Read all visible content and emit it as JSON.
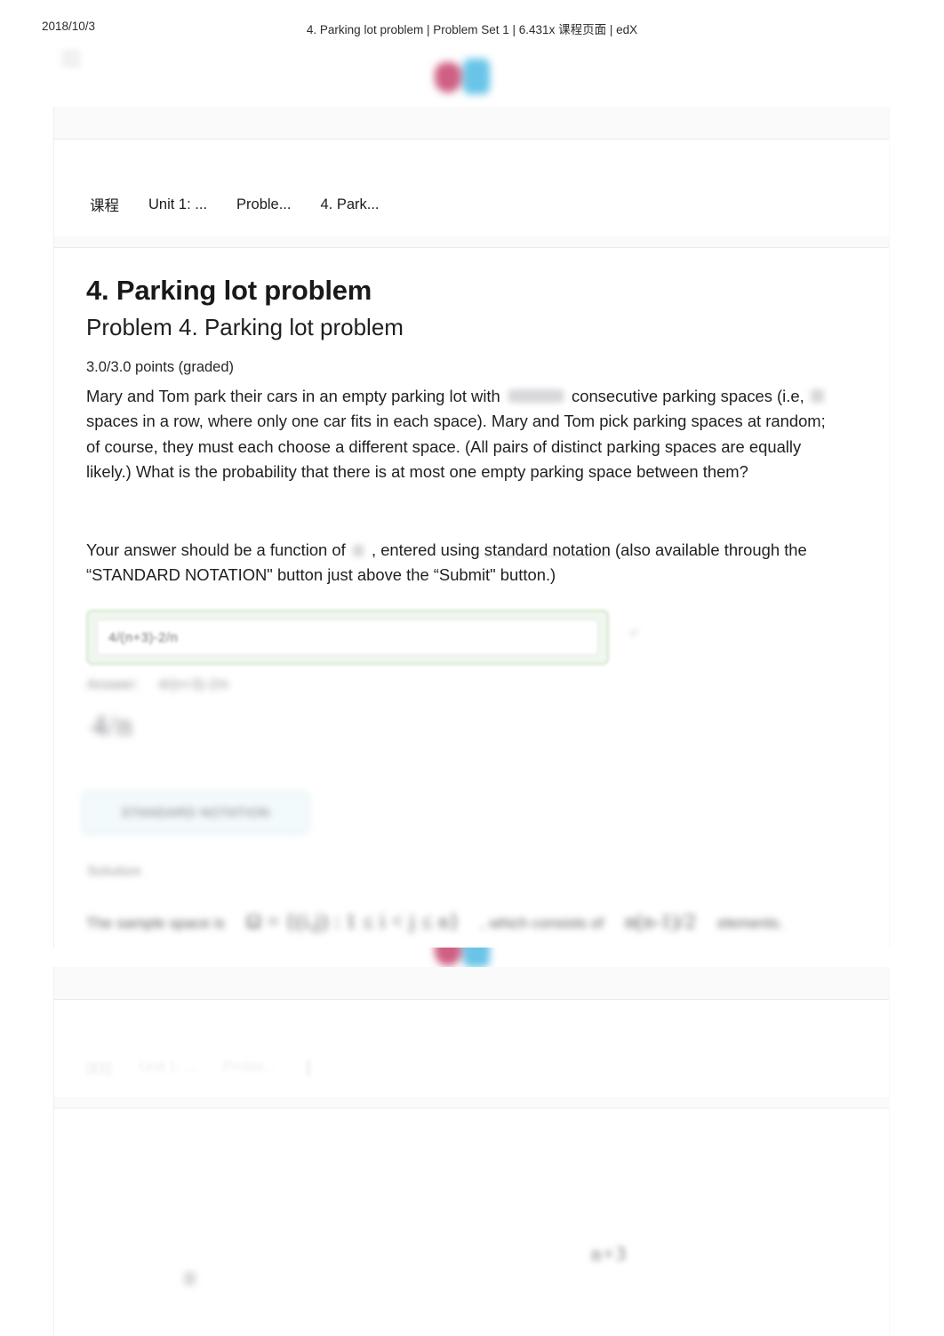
{
  "print_header": {
    "date": "2018/10/3",
    "title": "4. Parking lot problem | Problem Set 1 | 6.431x 课程页面 | edX"
  },
  "brand": {
    "logo_name": "edx-logo",
    "pink": "#cf5f83",
    "blue": "#68c4e8"
  },
  "nav": {
    "menu_icon": "hamburger-menu-icon",
    "breadcrumb": [
      {
        "label": "课程"
      },
      {
        "label": "Unit 1: ..."
      },
      {
        "label": "Proble..."
      },
      {
        "label": "4. Park..."
      }
    ],
    "breadcrumb_page2": [
      {
        "label": "课程"
      },
      {
        "label": "Unit 1: ..."
      },
      {
        "label": "Proble..."
      }
    ],
    "kebab_icon": "kebab-menu-icon"
  },
  "problem": {
    "title": "4. Parking lot problem",
    "subtitle": "Problem 4. Parking lot problem",
    "points": "3.0/3.0 points (graded)",
    "paragraph_1": {
      "part_1": "Mary and Tom park their cars in an empty parking lot with",
      "math_1": "n+3",
      "part_2": "consecutive parking spaces (i.e,",
      "math_2": "n",
      "part_3": "spaces in a row, where only one car fits in each space). Mary and Tom pick parking spaces at random; of course, they must each choose a different space. (All pairs of distinct parking spaces are equally likely.) What is the probability that there is at most one empty parking space between them?"
    },
    "paragraph_2": {
      "part_1": "Your answer should be a function of",
      "math_1": "n",
      "part_2": ", entered using",
      "link": "standard notation",
      "part_3": "(also available through the “STANDARD NOTATION\" button just above the “Submit\" button.)"
    }
  },
  "answer": {
    "input_value": "4/(n+3)-2/n",
    "input_placeholder": "",
    "status": "correct",
    "status_border_color": "#cfe4c9",
    "correct_icon": "check-circle-icon",
    "echo_label": "Answer:",
    "echo_value": "4/(n+3)-2/n",
    "rendered_answer": "4/n"
  },
  "controls": {
    "notation_button": "Standard Notation",
    "notation_border_color": "#e0eef2"
  },
  "solution": {
    "heading": "Solution",
    "line_prefix": "The sample space is",
    "line_math_1": "Ω = {(i,j) : 1 ≤ i < j ≤ n}",
    "line_middle": ", which consists of",
    "line_math_2": "n(n-1)/2",
    "line_suffix": "elements."
  },
  "page2": {
    "mark": "◼",
    "math": "n+3"
  }
}
